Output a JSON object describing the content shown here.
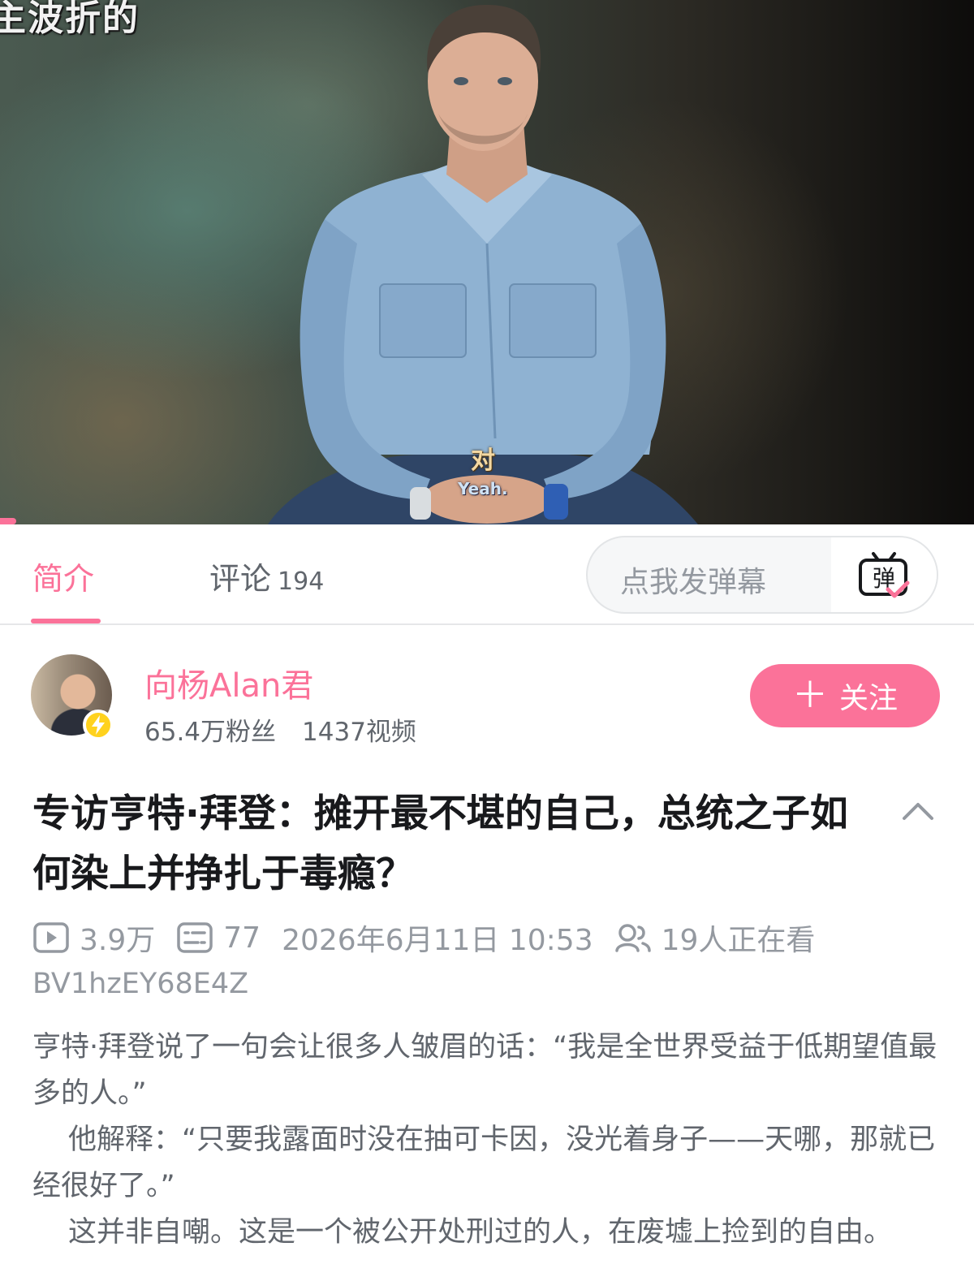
{
  "video": {
    "top_caption": "主波折的",
    "subtitle_cn": "对",
    "subtitle_en": "Yeah.",
    "progress": 0.017
  },
  "tabs": {
    "intro_label": "简介",
    "comments_label": "评论",
    "comments_count": "194",
    "danmaku_placeholder": "点我发弹幕",
    "danmaku_icon_char": "弹"
  },
  "uploader": {
    "name": "向杨Alan君",
    "followers": "65.4万粉丝",
    "videos": "1437视频",
    "follow_label": "关注"
  },
  "title": "专访亨特·拜登：摊开最不堪的自己，总统之子如何染上并挣扎于毒瘾？",
  "meta": {
    "views": "3.9万",
    "danmaku_count": "77",
    "datetime": "2026年6月11日 10:53",
    "watching": "19人正在看",
    "bvid": "BV1hzEY68E4Z"
  },
  "description": [
    "亨特·拜登说了一句会让很多人皱眉的话：“我是全世界受益于低期望值最多的人。”",
    "他解释：“只要我露面时没在抽可卡因，没光着身子——天哪，那就已经很好了。”",
    "这并非自嘲。这是一个被公开处刑过的人，在废墟上捡到的自由。"
  ],
  "colors": {
    "accent": "#fb7299",
    "text_primary": "#18191c",
    "text_secondary": "#61666d",
    "text_muted": "#9499a0",
    "badge": "#ffd21e"
  }
}
